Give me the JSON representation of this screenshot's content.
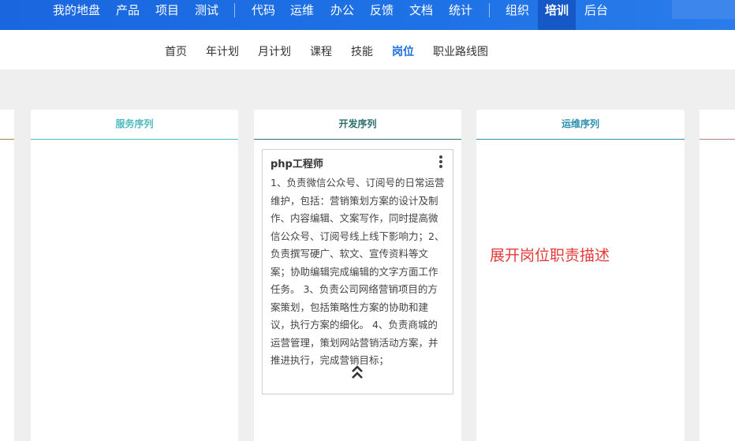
{
  "top_nav": {
    "items": [
      "我的地盘",
      "产品",
      "项目",
      "测试",
      "代码",
      "运维",
      "办公",
      "反馈",
      "文档",
      "统计",
      "组织",
      "培训",
      "后台"
    ],
    "active": "培训"
  },
  "sub_nav": {
    "items": [
      "首页",
      "年计划",
      "月计划",
      "课程",
      "技能",
      "岗位",
      "职业路线图"
    ],
    "active": "岗位"
  },
  "columns": [
    {
      "title": "服务序列",
      "color": "#4dbbbd"
    },
    {
      "title": "开发序列",
      "color": "#2e6f6f"
    },
    {
      "title": "运维序列",
      "color": "#2a8fb0"
    }
  ],
  "card": {
    "title": "php工程师",
    "description": "1、负责微信公众号、订阅号的日常运营维护，包括：营销策划方案的设计及制作、内容编辑、文案写作，同时提高微信公众号、订阅号线上线下影响力；2、负责撰写硬广、软文、宣传资料等文案；协助编辑完成编辑的文字方面工作任务。 3、负责公司网络营销项目的方案策划，包括策略性方案的协助和建议，执行方案的细化。 4、负责商城的运营管理，策划网站营销活动方案，并推进执行，完成营销目标；",
    "menu_icon": "more-vertical-icon",
    "collapse_icon": "chevron-double-up-icon"
  },
  "annotation": "展开岗位职责描述",
  "colors": {
    "nav_bg": "#1f6fe0",
    "accent": "#1f6fe0",
    "annotation": "#e53a3a"
  }
}
